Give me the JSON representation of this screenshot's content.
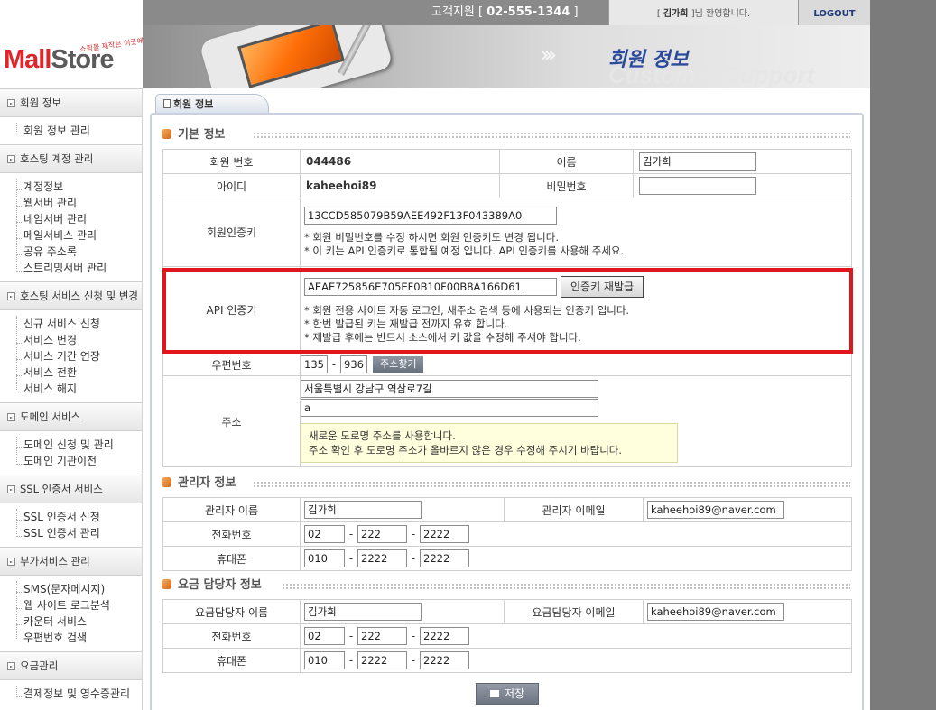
{
  "logo": {
    "brand_a": "Mall",
    "brand_b": "Store",
    "tagline": "쇼핑몰 제작은 이곳에서!"
  },
  "header": {
    "support_label": "고객지원",
    "support_phone": "02-555-1344",
    "user_name": "김가희",
    "welcome_suffix": "님 환영합니다.",
    "logout_label": "LOGOUT",
    "banner_title": "회원 정보",
    "banner_subtitle": "Customer Support"
  },
  "sidebar": [
    {
      "title": "회원 정보",
      "items": [
        "회원 정보 관리"
      ]
    },
    {
      "title": "호스팅 계정 관리",
      "items": [
        "계정정보",
        "웹서버 관리",
        "네임서버 관리",
        "메일서비스 관리",
        "공유 주소록",
        "스트리밍서버 관리"
      ]
    },
    {
      "title": "호스팅 서비스 신청 및 변경",
      "items": [
        "신규 서비스 신청",
        "서비스 변경",
        "서비스 기간 연장",
        "서비스 전환",
        "서비스 해지"
      ]
    },
    {
      "title": "도메인 서비스",
      "items": [
        "도메인 신청 및 관리",
        "도메인 기관이전"
      ]
    },
    {
      "title": "SSL 인증서 서비스",
      "items": [
        "SSL 인증서 신청",
        "SSL 인증서 관리"
      ]
    },
    {
      "title": "부가서비스 관리",
      "items": [
        "SMS(문자메시지)",
        "웹 사이트 로그분석",
        "카운터 서비스",
        "우편번호 검색"
      ]
    },
    {
      "title": "요금관리",
      "items": [
        "결제정보 및 영수증관리"
      ]
    }
  ],
  "tab": {
    "label": "회원 정보"
  },
  "basic": {
    "title": "기본 정보",
    "member_no_label": "회원 번호",
    "member_no": "044486",
    "name_label": "이름",
    "name": "김가희",
    "id_label": "아이디",
    "id": "kaheehoi89",
    "password_label": "비밀번호",
    "password": "",
    "auth_key_label": "회원인증키",
    "auth_key": "13CCD585079B59AEE492F13F043389A0",
    "auth_note1": "* 회원 비밀번호를 수정 하시면 회원 인증키도 변경 됩니다.",
    "auth_note2": "* 이 키는 API 인증키로 통합될 예정 입니다. API 인증키를 사용해 주세요.",
    "api_key_label": "API 인증키",
    "api_key": "AEAE725856E705EF0B10F00B8A166D61",
    "reissue_label": "인증키 재발급",
    "api_note1": "* 회원 전용 사이트 자동 로그인, 새주소 검색 등에 사용되는 인증키 입니다.",
    "api_note2": "* 한번 발급된 키는 재발급 전까지 유효 합니다.",
    "api_note3": "* 재발급 후에는 반드시 소스에서 키 값을 수정해 주셔야 합니다.",
    "zip_label": "우편번호",
    "zip1": "135",
    "zip2": "936",
    "zip_search_label": "주소찾기",
    "address_label": "주소",
    "address1": "서울특별시 강남구 역삼로7길",
    "address2": "a",
    "address_note1": "새로운 도로명 주소를 사용합니다.",
    "address_note2": "주소 확인 후 도로명 주소가 올바르지 않은 경우 수정해 주시기 바랍니다."
  },
  "admin": {
    "title": "관리자 정보",
    "name_label": "관리자 이름",
    "name": "김가희",
    "email_label": "관리자 이메일",
    "email": "kaheehoi89@naver.com",
    "phone_label": "전화번호",
    "phone": [
      "02",
      "222",
      "2222"
    ],
    "mobile_label": "휴대폰",
    "mobile": [
      "010",
      "2222",
      "2222"
    ]
  },
  "billing": {
    "title": "요금 담당자 정보",
    "name_label": "요금담당자 이름",
    "name": "김가희",
    "email_label": "요금담당자 이메일",
    "email": "kaheehoi89@naver.com",
    "phone_label": "전화번호",
    "phone": [
      "02",
      "222",
      "2222"
    ],
    "mobile_label": "휴대폰",
    "mobile": [
      "010",
      "2222",
      "2222"
    ]
  },
  "save_label": "저장"
}
